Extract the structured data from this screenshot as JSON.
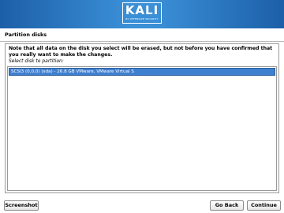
{
  "header": {
    "logo_text": "KALI",
    "logo_subtext": "BY OFFENSIVE SECURITY"
  },
  "page": {
    "title": "Partition disks"
  },
  "main": {
    "notice": "Note that all data on the disk you select will be erased, but not before you have confirmed that you really want to make the changes.",
    "prompt": "Select disk to partition:",
    "disks": [
      {
        "label": "SCSI3 (0,0,0) (sda) - 26.8 GB VMware, VMware Virtual S",
        "selected": true
      }
    ]
  },
  "buttons": {
    "screenshot": "Screenshot",
    "go_back": "Go Back",
    "continue": "Continue"
  },
  "colors": {
    "banner_blue": "#3a8fd6",
    "selection_blue": "#3f7fd0"
  }
}
